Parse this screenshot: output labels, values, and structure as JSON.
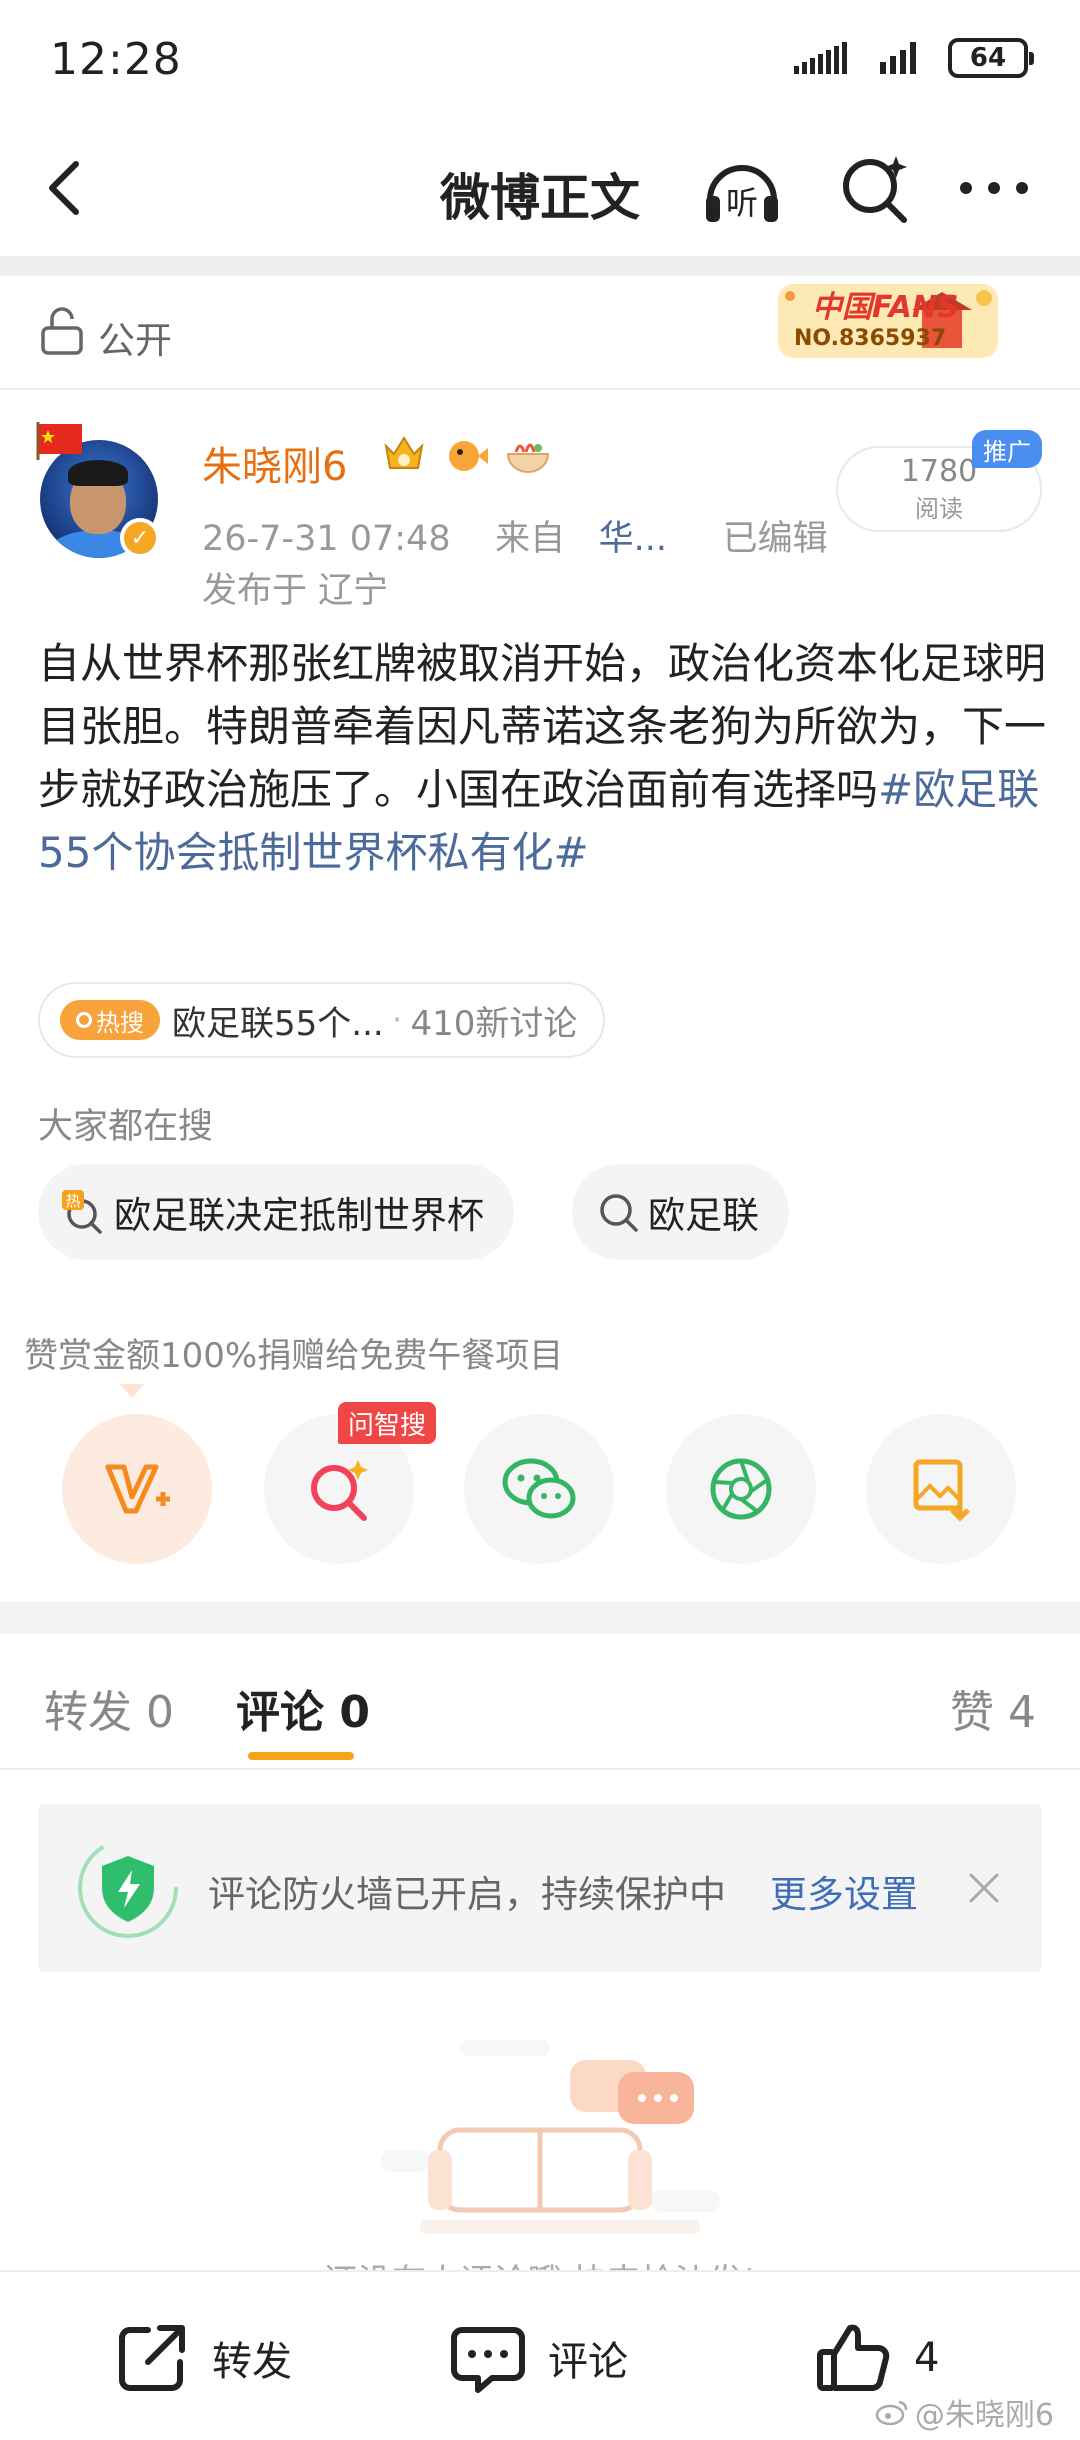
{
  "status_bar": {
    "time": "12:28",
    "battery": "64"
  },
  "nav": {
    "title": "微博正文",
    "listen_label": "听"
  },
  "privacy": {
    "label": "公开"
  },
  "fans_badge": {
    "title": "中国FANS",
    "number": "NO.8365937"
  },
  "author": {
    "name": "朱晓刚6",
    "date": "26-7-31 07:48",
    "from_prefix": "来自",
    "source": "华...",
    "edited": "已编辑",
    "location": "发布于 辽宁"
  },
  "stats": {
    "read_count": "1780",
    "read_label": "阅读",
    "promo": "推广"
  },
  "post": {
    "body": "自从世界杯那张红牌被取消开始，政治化资本化足球明目张胆。特朗普牵着因凡蒂诺这条老狗为所欲为，下一步就好政治施压了。小国在政治面前有选择吗",
    "hashtag": "#欧足联55个协会抵制世界杯私有化#"
  },
  "hot_search": {
    "chip_label": "热搜",
    "topic": "欧足联55个...",
    "dot": "·",
    "discussion": "410新讨论"
  },
  "everyone_searching": {
    "label": "大家都在搜",
    "items": [
      {
        "hot_mark": "热",
        "label": "欧足联决定抵制世界杯"
      },
      {
        "label": "欧足联"
      }
    ]
  },
  "reward": {
    "text": "赞赏金额100%捐赠给免费午餐项目"
  },
  "share": {
    "ask_tag": "问智搜"
  },
  "tabs": {
    "repost": "转发 0",
    "comment": "评论 0",
    "like": "赞 4"
  },
  "firewall": {
    "text": "评论防火墙已开启，持续保护中",
    "link": "更多设置"
  },
  "empty_state": {
    "text": "还没有人评论哦 快来抢沙发!"
  },
  "bottom_bar": {
    "repost": "转发",
    "comment": "评论",
    "like_count": "4"
  },
  "watermark": {
    "text": "@朱晓刚6"
  },
  "colors": {
    "accent_orange": "#f7a21b",
    "link_blue": "#4c6a9a",
    "username_orange": "#e86f10",
    "hot_red": "#f04646"
  }
}
